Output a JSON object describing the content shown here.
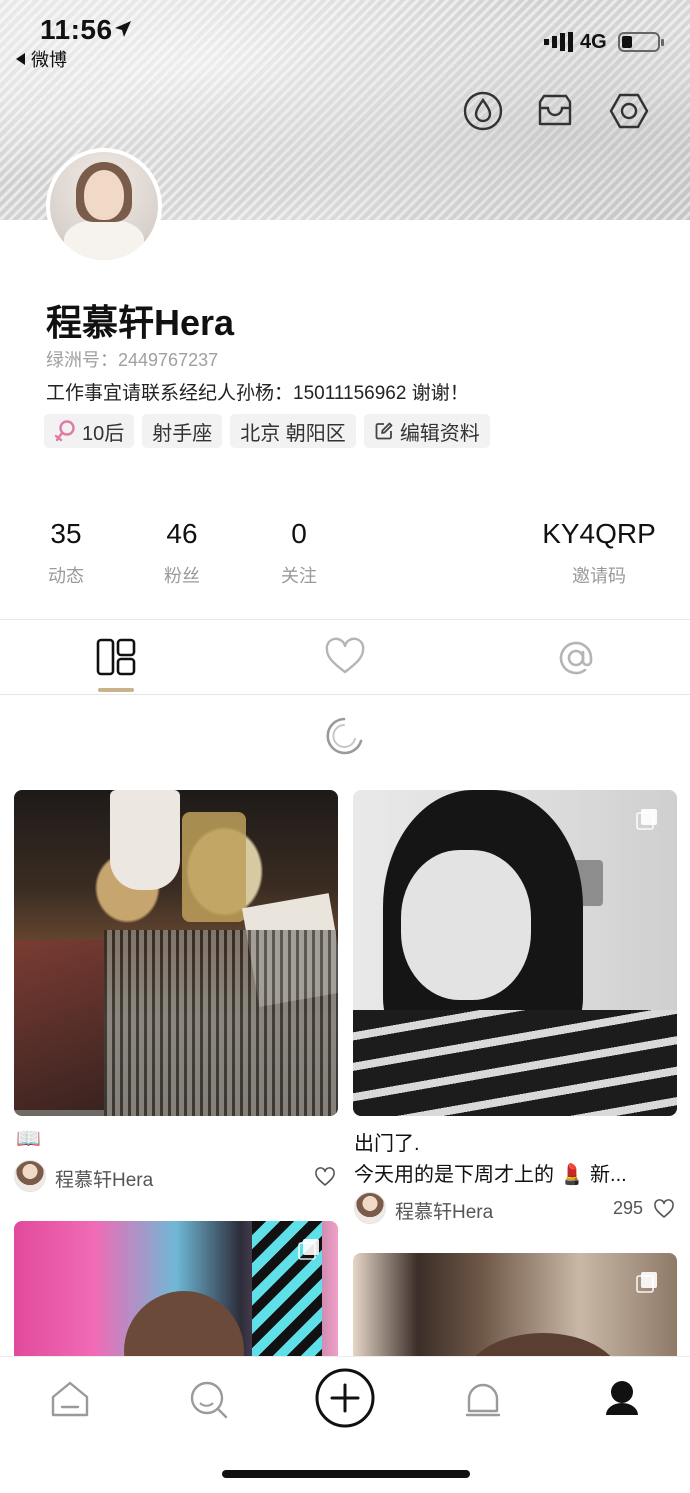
{
  "status_bar": {
    "time": "11:56",
    "back_app": "微博",
    "network": "4G"
  },
  "header_icons": {
    "left": "drop-icon",
    "middle": "inbox-icon",
    "right": "settings-icon"
  },
  "profile": {
    "name": "程慕轩Hera",
    "oasis_id": "绿洲号：2449767237",
    "bio": "工作事宜请联系经纪人孙杨：15011156962 谢谢！",
    "tags": [
      {
        "label": "10后",
        "icon": "female-icon"
      },
      {
        "label": "射手座"
      },
      {
        "label": "北京 朝阳区"
      },
      {
        "label": "编辑资料",
        "icon": "edit-icon"
      }
    ]
  },
  "stats": [
    {
      "num": "35",
      "label": "动态"
    },
    {
      "num": "46",
      "label": "粉丝"
    },
    {
      "num": "0",
      "label": "关注"
    },
    {
      "num": "KY4QRP",
      "label": "邀请码"
    }
  ],
  "tabs": [
    {
      "icon": "grid-icon",
      "active": true
    },
    {
      "icon": "heart-icon",
      "active": false
    },
    {
      "icon": "at-icon",
      "active": false
    }
  ],
  "posts": [
    {
      "emoji": "📖",
      "text": "",
      "author": "程慕轩Hera",
      "likes": ""
    },
    {
      "text_line1": "出门了.",
      "text_line2": "今天用的是下周才上的 💄 新...",
      "author": "程慕轩Hera",
      "likes": "295"
    }
  ],
  "colors": {
    "accent": "#c9b38a",
    "text_primary": "#111111",
    "text_secondary": "#9a9a9a"
  }
}
